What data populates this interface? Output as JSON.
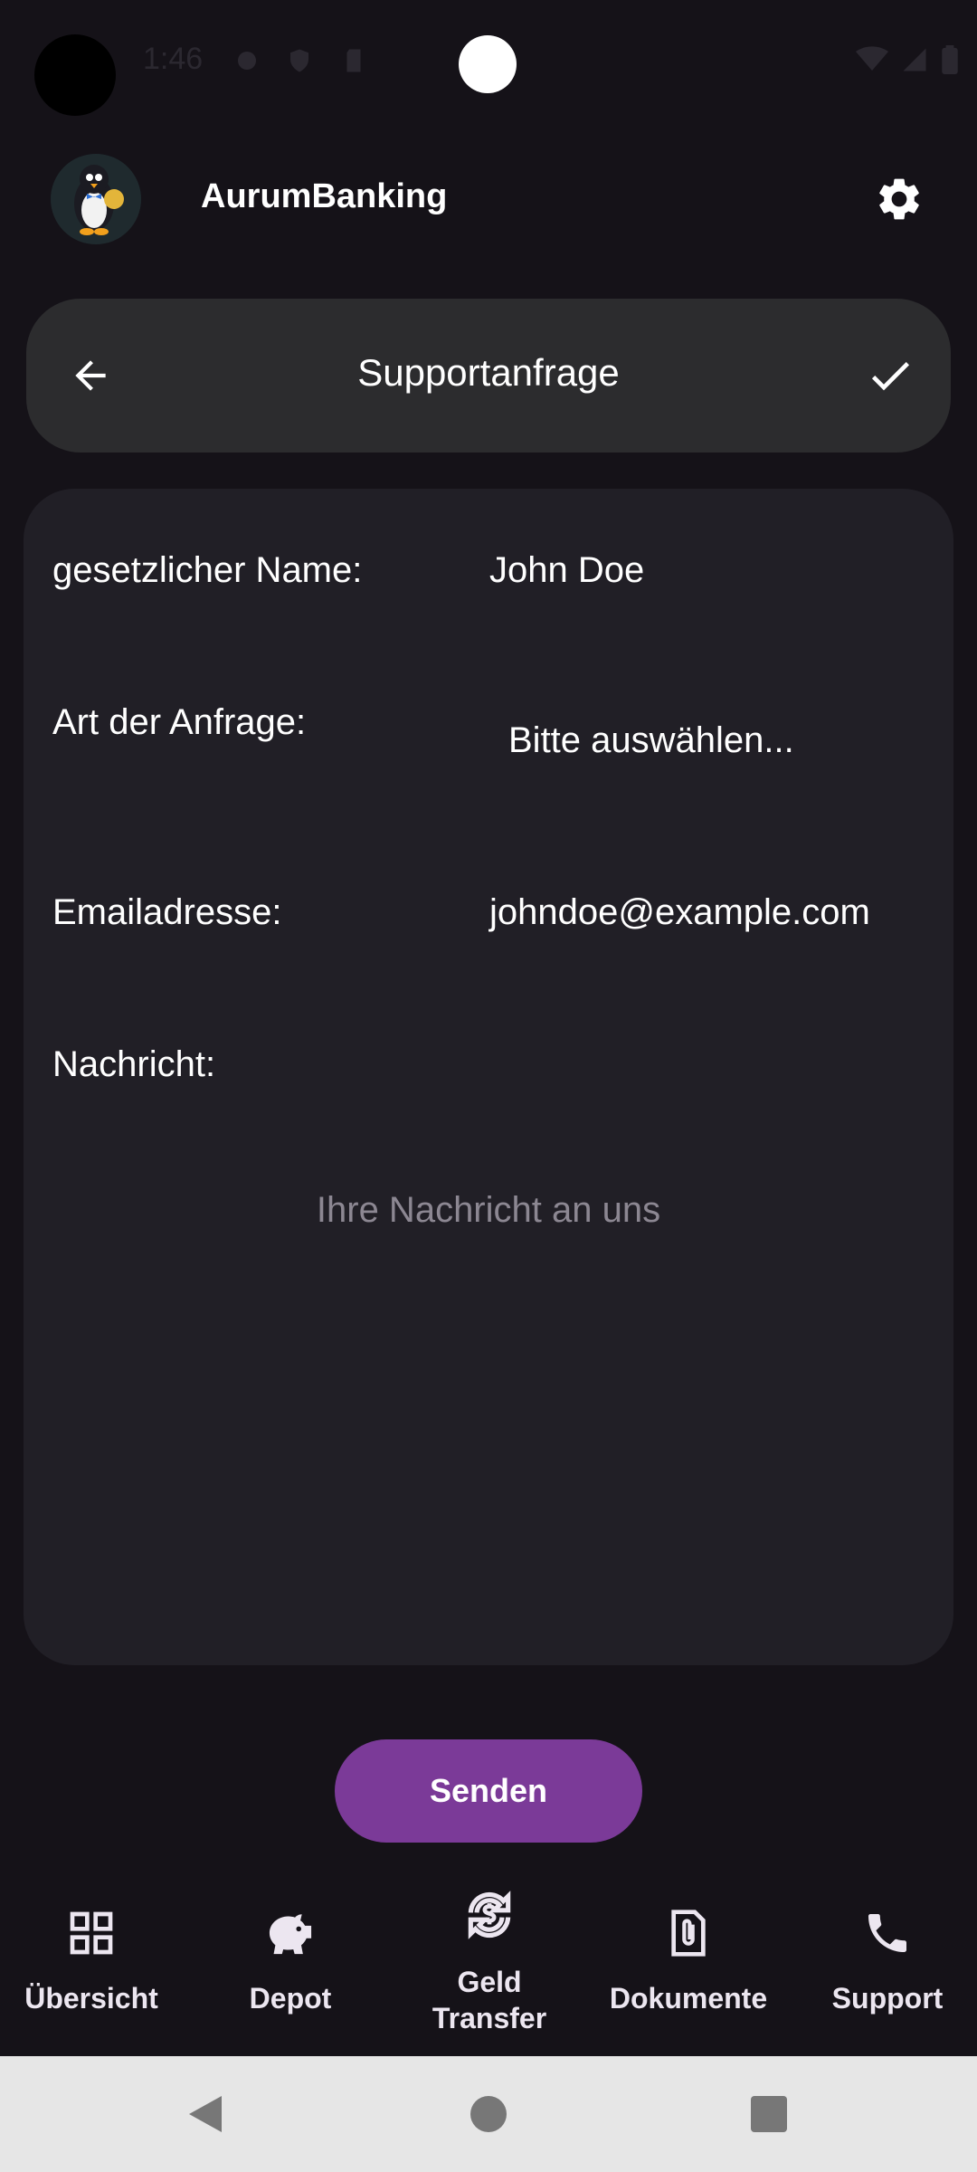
{
  "status_bar": {
    "time": "1:46"
  },
  "header": {
    "app_title": "AurumBanking"
  },
  "top_bar": {
    "title": "Supportanfrage"
  },
  "form": {
    "name_label": "gesetzlicher Name:",
    "name_value": "John Doe",
    "request_type_label": "Art der Anfrage:",
    "request_type_value": "Bitte auswählen...",
    "email_label": "Emailadresse:",
    "email_value": "johndoe@example.com",
    "message_label": "Nachricht:",
    "message_placeholder": "Ihre Nachricht an uns"
  },
  "send_button": {
    "label": "Senden"
  },
  "bottom_nav": {
    "items": [
      {
        "label": "Übersicht",
        "icon": "grid-icon"
      },
      {
        "label": "Depot",
        "icon": "piggy-bank-icon"
      },
      {
        "label_line1": "Geld",
        "label_line2": "Transfer",
        "icon": "money-transfer-icon"
      },
      {
        "label": "Dokumente",
        "icon": "paperclip-document-icon"
      },
      {
        "label": "Support",
        "icon": "phone-icon"
      }
    ]
  },
  "colors": {
    "background": "#151218",
    "card": "#211f26",
    "top_bar": "#2c2c2e",
    "accent": "#7b3a98"
  }
}
